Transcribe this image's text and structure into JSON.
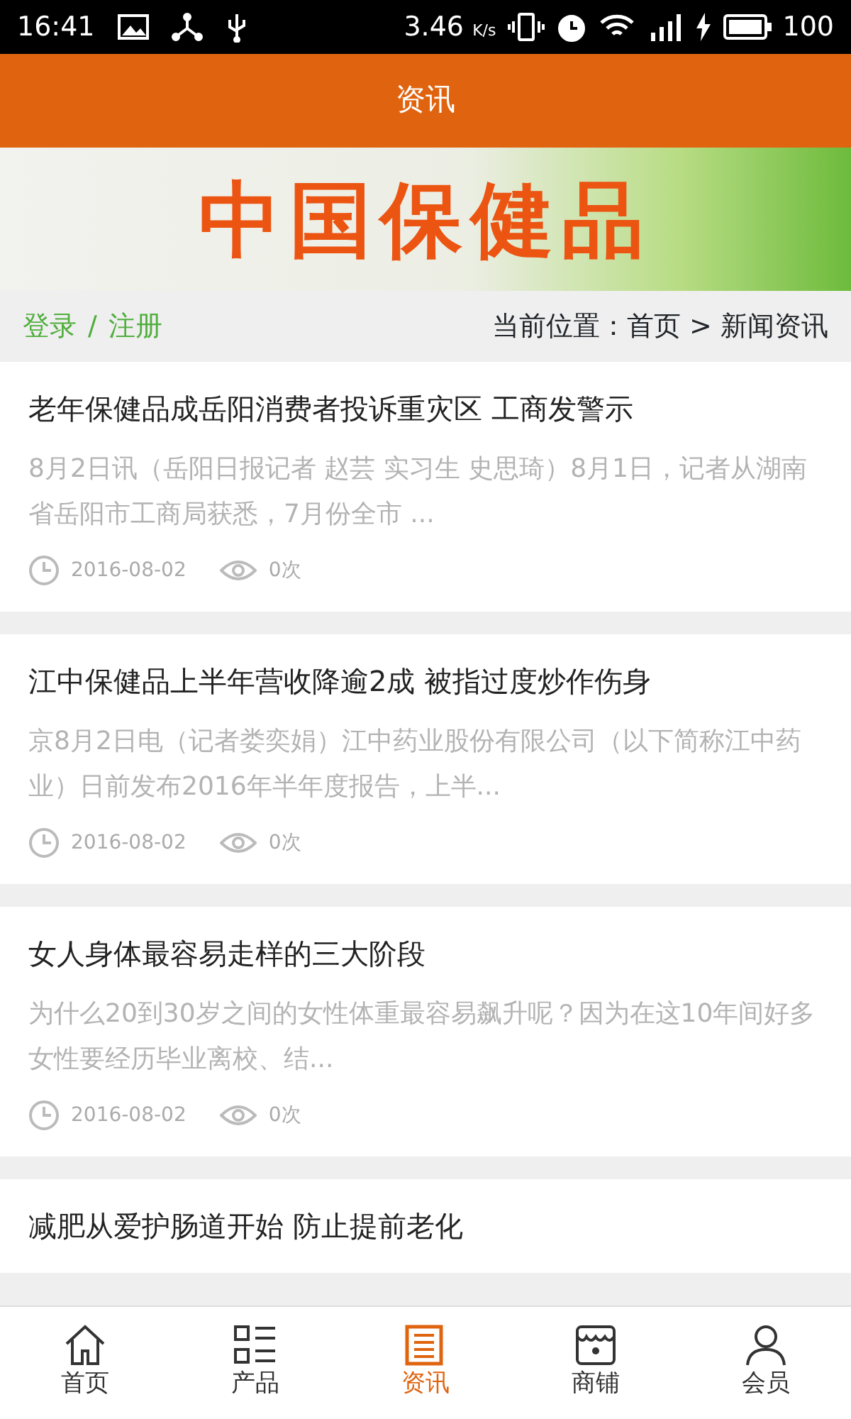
{
  "status_bar": {
    "time": "16:41",
    "speed": "3.46",
    "speed_unit": "K/s",
    "battery": "100"
  },
  "header": {
    "title": "资讯"
  },
  "banner": {
    "text": "中国保健品"
  },
  "breadcrumb": {
    "login": "登录",
    "separator": "/",
    "register": "注册",
    "location": "当前位置：首页 > 新闻资讯"
  },
  "articles": [
    {
      "title": "老年保健品成岳阳消费者投诉重灾区 工商发警示",
      "summary": "8月2日讯（岳阳日报记者 赵芸 实习生 史思琦）8月1日，记者从湖南省岳阳市工商局获悉，7月份全市 ...",
      "date": "2016-08-02",
      "views": "0次"
    },
    {
      "title": "江中保健品上半年营收降逾2成 被指过度炒作伤身",
      "summary": "京8月2日电（记者娄奕娟）江中药业股份有限公司（以下简称江中药业）日前发布2016年半年度报告，上半...",
      "date": "2016-08-02",
      "views": "0次"
    },
    {
      "title": "女人身体最容易走样的三大阶段",
      "summary": " 为什么20到30岁之间的女性体重最容易飙升呢？因为在这10年间好多女性要经历毕业离校、结...",
      "date": "2016-08-02",
      "views": "0次"
    },
    {
      "title": "减肥从爱护肠道开始 防止提前老化"
    }
  ],
  "tabs": [
    {
      "label": "首页",
      "kind": "home",
      "selected": false
    },
    {
      "label": "产品",
      "kind": "products",
      "selected": false
    },
    {
      "label": "资讯",
      "kind": "news",
      "selected": true
    },
    {
      "label": "商铺",
      "kind": "shop",
      "selected": false
    },
    {
      "label": "会员",
      "kind": "member",
      "selected": false
    }
  ]
}
